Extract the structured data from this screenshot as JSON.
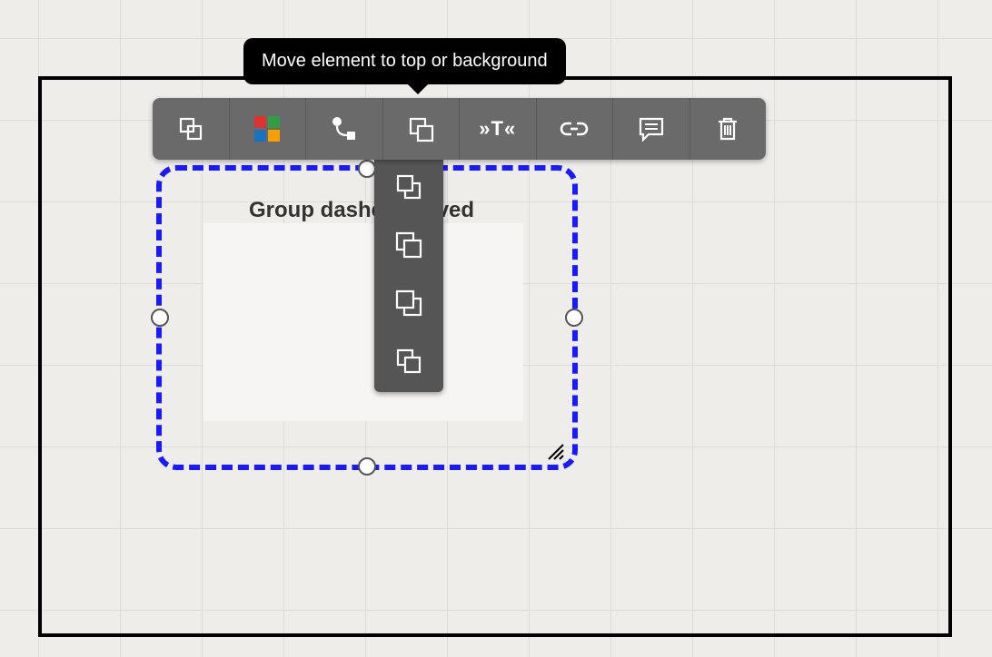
{
  "tooltip": {
    "text": "Move element to top or background"
  },
  "toolbar": {
    "buttons": [
      {
        "name": "copy-icon"
      },
      {
        "name": "color-palette-icon"
      },
      {
        "name": "connector-icon"
      },
      {
        "name": "layer-order-icon"
      },
      {
        "name": "text-style-icon",
        "label": "»T«"
      },
      {
        "name": "link-icon"
      },
      {
        "name": "comment-icon"
      },
      {
        "name": "trash-icon"
      }
    ]
  },
  "layer_menu": {
    "items": [
      {
        "name": "bring-to-front-icon"
      },
      {
        "name": "bring-forward-icon"
      },
      {
        "name": "send-backward-icon"
      },
      {
        "name": "send-to-back-icon"
      }
    ]
  },
  "group": {
    "label": "Group dashed curved"
  },
  "colors": {
    "accent": "#1a1aff",
    "toolbar_bg": "#6a6a6a",
    "menu_bg": "#555555",
    "palette": [
      "#e03131",
      "#2f9e44",
      "#1971c2",
      "#f59f00"
    ]
  }
}
